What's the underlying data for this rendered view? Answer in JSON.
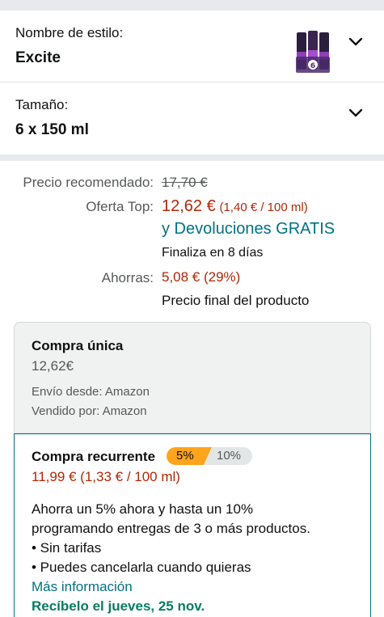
{
  "style_selector": {
    "label": "Nombre de estilo:",
    "value": "Excite"
  },
  "size_selector": {
    "label": "Tamaño:",
    "value": "6 x 150 ml"
  },
  "pricing": {
    "recommended_label": "Precio recomendado:",
    "recommended_value": "17,70 €",
    "offer_label": "Oferta Top:",
    "offer_price": "12,62 €",
    "offer_unit": "(1,40 € / 100 ml)",
    "returns_text": "y Devoluciones GRATIS",
    "ends_text": "Finaliza en 8 días",
    "savings_label": "Ahorras:",
    "savings_value": "5,08 € (29%)",
    "final_note": "Precio final del producto"
  },
  "one_time": {
    "title": "Compra única",
    "price": "12,62€",
    "ship_from": "Envío desde: Amazon",
    "sold_by": "Vendido por: Amazon"
  },
  "subscribe": {
    "title": "Compra recurrente",
    "badge_a": "5%",
    "badge_b": "10%",
    "price": "11,99 € (1,33 € / 100 ml)",
    "desc_1": "Ahorra un 5% ahora y hasta un 10%",
    "desc_2": "programando entregas de 3 o más productos.",
    "bullet_1": "• Sin tarifas",
    "bullet_2": "• Puedes cancelarla cuando quieras",
    "more_info": "Más información",
    "delivery": "Recíbelo el jueves, 25 nov."
  },
  "colors": {
    "price_red": "#b12704",
    "link_teal": "#007185",
    "green": "#067d62",
    "badge_orange": "#ffa41c"
  }
}
